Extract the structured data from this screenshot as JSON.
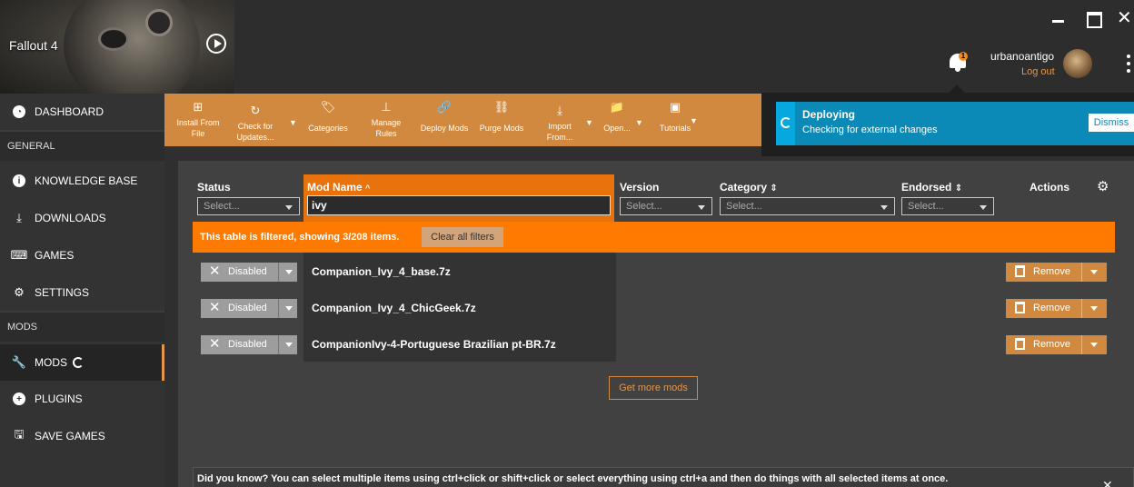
{
  "game": {
    "title": "Fallout 4"
  },
  "user": {
    "name": "urbanoantigo",
    "logout": "Log out",
    "notification_count": "1"
  },
  "sidebar": {
    "dashboard": "DASHBOARD",
    "general_header": "GENERAL",
    "knowledge_base": "KNOWLEDGE BASE",
    "downloads": "DOWNLOADS",
    "games": "GAMES",
    "settings": "SETTINGS",
    "mods_header": "MODS",
    "mods": "MODS",
    "plugins": "PLUGINS",
    "save_games": "SAVE GAMES"
  },
  "toolbar": {
    "install_from_file": [
      "Install From",
      "File"
    ],
    "check_for_updates": [
      "Check for",
      "Updates..."
    ],
    "categories": "Categories",
    "manage_rules": [
      "Manage",
      "Rules"
    ],
    "deploy_mods": "Deploy Mods",
    "purge_mods": "Purge Mods",
    "import_from": [
      "Import",
      "From..."
    ],
    "open": "Open...",
    "tutorials": "Tutorials"
  },
  "notification": {
    "title": "Deploying",
    "message": "Checking for external changes",
    "dismiss": "Dismiss"
  },
  "table": {
    "columns": {
      "status": "Status",
      "mod_name": "Mod Name",
      "version": "Version",
      "category": "Category",
      "endorsed": "Endorsed",
      "actions": "Actions"
    },
    "select_placeholder": "Select...",
    "mod_name_filter": "ivy",
    "filter_message": "This table is filtered, showing 3/208 items.",
    "clear_filters": "Clear all filters",
    "rows": [
      {
        "status": "Disabled",
        "name": "Companion_Ivy_4_base.7z",
        "action": "Remove"
      },
      {
        "status": "Disabled",
        "name": "Companion_Ivy_4_ChicGeek.7z",
        "action": "Remove"
      },
      {
        "status": "Disabled",
        "name": "CompanionIvy-4-Portuguese Brazilian pt-BR.7z",
        "action": "Remove"
      }
    ],
    "get_more": "Get more mods"
  },
  "tip": {
    "text": "Did you know? You can select multiple items using ctrl+click or shift+click or select everything using ctrl+a and then do things with all selected items at once."
  },
  "colors": {
    "accent": "#d1893f",
    "filter_orange": "#ff7a00",
    "notification_blue": "#0b8ab8"
  }
}
